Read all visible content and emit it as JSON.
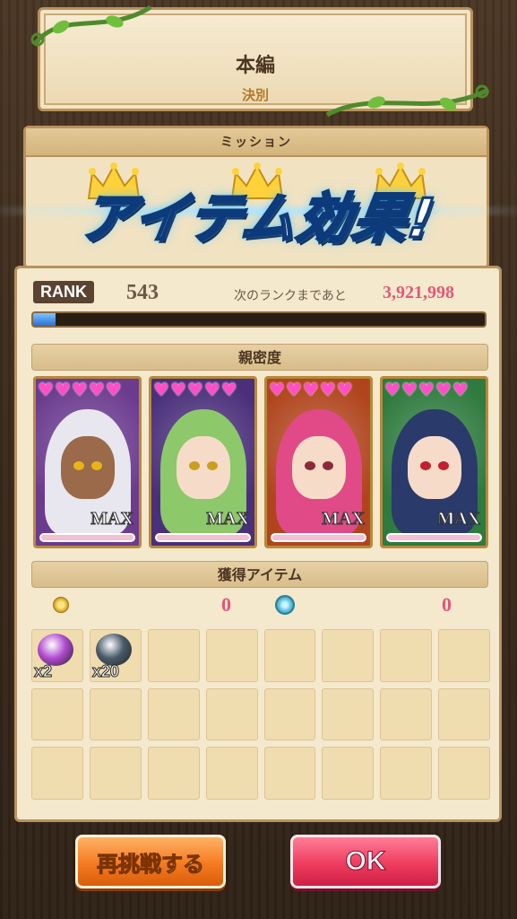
{
  "header": {
    "title": "本編",
    "subtitle": "決別"
  },
  "mission": {
    "label": "ミッション"
  },
  "banner": {
    "text": "アイテム効果!"
  },
  "rank": {
    "label": "RANK",
    "value": "543",
    "next_label": "次のランクまであと",
    "next_value": "3,921,998",
    "exp_progress": 0.05
  },
  "affection": {
    "header": "親密度",
    "characters": [
      {
        "hearts": 5,
        "status": "MAX",
        "bg": "#6b3b8e",
        "hair": "#e8e6ee",
        "skin": "#9a6a4a",
        "eye": "#e9b416"
      },
      {
        "hearts": 5,
        "status": "MAX",
        "bg": "#4a2f7a",
        "hair": "#8dc86a",
        "skin": "#f6dcc8",
        "eye": "#c8a020"
      },
      {
        "hearts": 5,
        "status": "MAX",
        "bg": "#b0451d",
        "hair": "#e04a86",
        "skin": "#f6dcc8",
        "eye": "#8a2a3a"
      },
      {
        "hearts": 5,
        "status": "MAX",
        "bg": "#2f7a3e",
        "hair": "#2a3a6a",
        "skin": "#f6dcc8",
        "eye": "#c02030"
      }
    ]
  },
  "items": {
    "header": "獲得アイテム",
    "coin_count": "0",
    "gem_count": "0",
    "slots": [
      {
        "count": "x2",
        "color": "#b04ad0"
      },
      {
        "count": "x20",
        "color": "#4a5a6a"
      }
    ]
  },
  "buttons": {
    "retry": "再挑戦する",
    "ok": "OK"
  },
  "colors": {
    "accent_pink": "#e0587a",
    "retry_orange": "#f57a1f",
    "ok_red": "#ef3c5f"
  }
}
